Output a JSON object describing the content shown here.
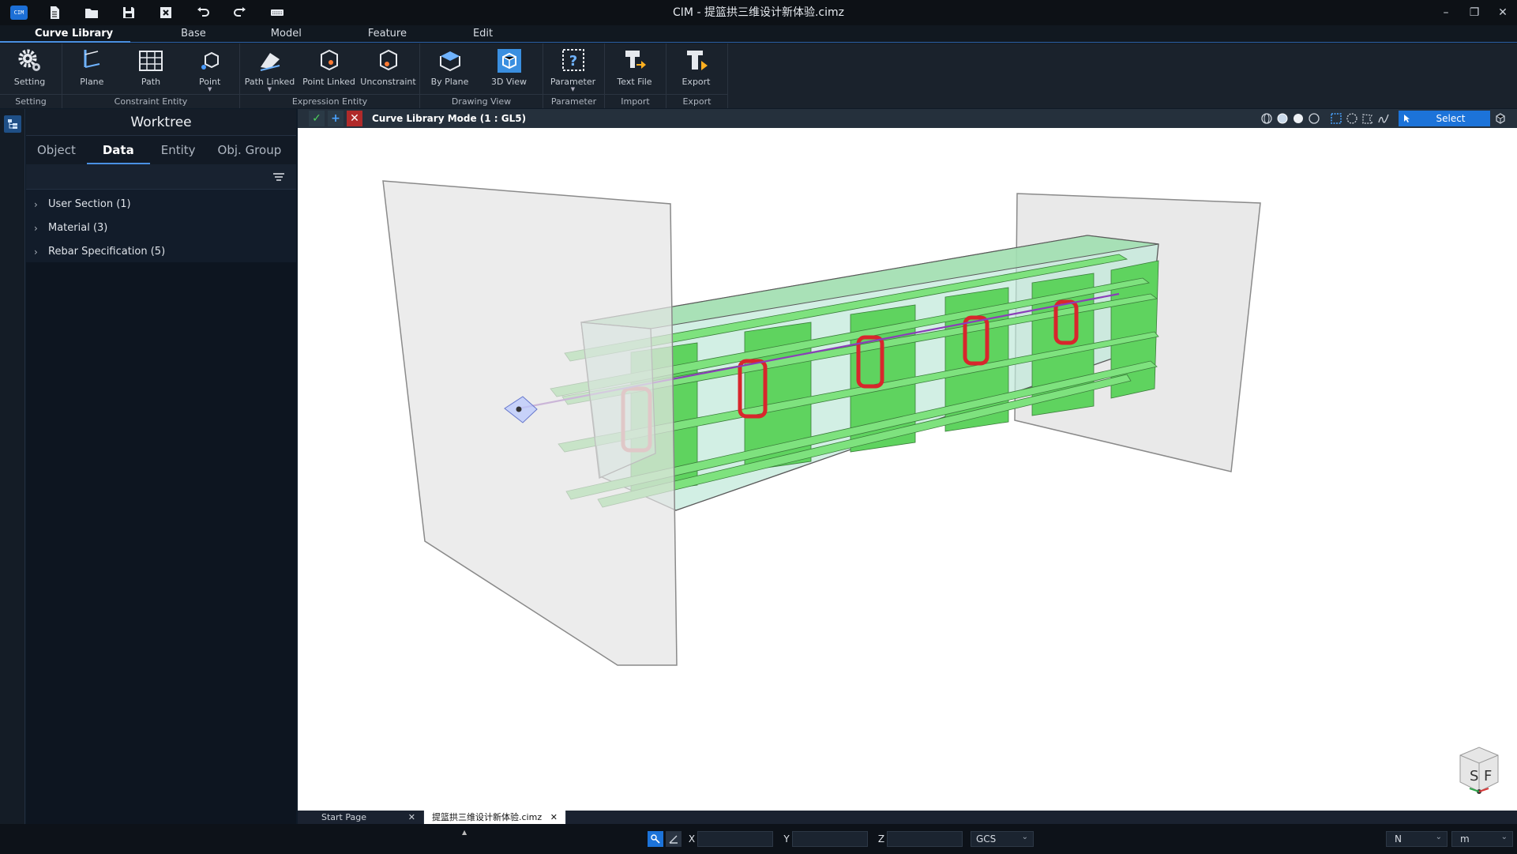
{
  "window": {
    "title": "CIM - 提篮拱三维设计新体验.cimz",
    "logo_text": "CIM"
  },
  "menu": {
    "tabs": [
      "Curve Library",
      "Base",
      "Model",
      "Feature",
      "Edit"
    ]
  },
  "ribbon": {
    "groups": [
      {
        "label": "Setting",
        "buttons": [
          "Setting"
        ]
      },
      {
        "label": "Constraint Entity",
        "buttons": [
          "Plane",
          "Path",
          "Point"
        ]
      },
      {
        "label": "Expression Entity",
        "buttons": [
          "Path Linked",
          "Point Linked",
          "Unconstraint"
        ]
      },
      {
        "label": "Drawing View",
        "buttons": [
          "By Plane",
          "3D View"
        ]
      },
      {
        "label": "Parameter",
        "buttons": [
          "Parameter"
        ]
      },
      {
        "label": "Import",
        "buttons": [
          "Text File"
        ]
      },
      {
        "label": "Export",
        "buttons": [
          "Export"
        ]
      }
    ]
  },
  "worktree": {
    "title": "Worktree",
    "tabs": [
      "Object",
      "Data",
      "Entity",
      "Obj. Group"
    ],
    "active_tab": "Data",
    "items": [
      "User Section (1)",
      "Material (3)",
      "Rebar Specification (5)"
    ]
  },
  "viewport": {
    "mode_label": "Curve Library Mode (1 : GL5)",
    "select_label": "Select",
    "navcube_labels": [
      "S",
      "F"
    ]
  },
  "doc_tabs": [
    {
      "label": "Start Page",
      "active": false
    },
    {
      "label": "提篮拱三维设计新体验.cimz",
      "active": true
    }
  ],
  "statusbar": {
    "x_label": "X",
    "y_label": "Y",
    "z_label": "Z",
    "coord_system": "GCS",
    "force_unit": "N",
    "length_unit": "m"
  },
  "colors": {
    "accent": "#1c73d9",
    "green_plate": "#5fd35f",
    "rebar_red": "#d8262c"
  }
}
